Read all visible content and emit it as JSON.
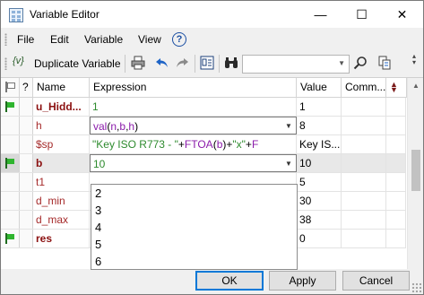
{
  "window": {
    "title": "Variable Editor",
    "minimize_glyph": "—",
    "maximize_glyph": "☐",
    "close_glyph": "✕"
  },
  "menu": {
    "items": [
      "File",
      "Edit",
      "Variable",
      "View"
    ],
    "help_glyph": "?"
  },
  "toolbar": {
    "duplicate_icon": "{v}",
    "duplicate_label": "Duplicate Variable",
    "search_value": "",
    "icons": [
      "print-icon",
      "undo-icon",
      "redo-icon",
      "page-icon",
      "binoculars-icon",
      "search-icon",
      "copy-icon",
      "overflow-icon"
    ]
  },
  "grid": {
    "headers": {
      "flag": "",
      "q": "?",
      "name": "Name",
      "expression": "Expression",
      "value": "Value",
      "comment": "Comm..."
    },
    "rows": [
      {
        "flag": true,
        "name": "u_Hidd...",
        "name_bold": true,
        "expr": "1",
        "expr_style": "green",
        "value": "1",
        "selected": false,
        "combo": false
      },
      {
        "flag": false,
        "name": "h",
        "name_bold": false,
        "expr_parts": [
          [
            "purple",
            "val"
          ],
          [
            "",
            "("
          ],
          [
            "purple",
            "n"
          ],
          [
            "",
            ","
          ],
          [
            "purple",
            "b"
          ],
          [
            "",
            ","
          ],
          [
            "purple",
            "h"
          ],
          [
            "",
            ")"
          ]
        ],
        "value": "8",
        "selected": false,
        "combo": true
      },
      {
        "flag": false,
        "name": "$sp",
        "name_bold": false,
        "expr_parts": [
          [
            "green",
            "\"Key ISO R773 - \""
          ],
          [
            "",
            "+"
          ],
          [
            "purple",
            "FTOA"
          ],
          [
            "",
            "("
          ],
          [
            "purple",
            "b"
          ],
          [
            "",
            ")"
          ],
          [
            "",
            "+"
          ],
          [
            "green",
            "\"x\""
          ],
          [
            "",
            "+"
          ],
          [
            "purple",
            "F"
          ]
        ],
        "value": "Key IS...",
        "selected": false,
        "combo": false
      },
      {
        "flag": true,
        "name": "b",
        "name_bold": true,
        "expr": "10",
        "expr_style": "green",
        "value": "10",
        "selected": true,
        "combo": true
      },
      {
        "flag": false,
        "name": "t1",
        "name_bold": false,
        "expr": "",
        "value": "5",
        "selected": false,
        "combo": false
      },
      {
        "flag": false,
        "name": "d_min",
        "name_bold": false,
        "expr": "",
        "value": "30",
        "selected": false,
        "combo": false
      },
      {
        "flag": false,
        "name": "d_max",
        "name_bold": false,
        "expr": "",
        "value": "38",
        "selected": false,
        "combo": false
      },
      {
        "flag": true,
        "name": "res",
        "name_bold": true,
        "expr": "",
        "value": "0",
        "selected": false,
        "combo": false
      }
    ]
  },
  "dropdown": {
    "options": [
      "2",
      "3",
      "4",
      "5",
      "6"
    ]
  },
  "buttons": {
    "ok": "OK",
    "apply": "Apply",
    "cancel": "Cancel"
  },
  "colors": {
    "name_text": "#a52a2a",
    "literal_green": "#2e8b2e",
    "identifier_purple": "#8b1cab",
    "flag_green": "#2fb52f",
    "default_button_border": "#0078d7"
  }
}
